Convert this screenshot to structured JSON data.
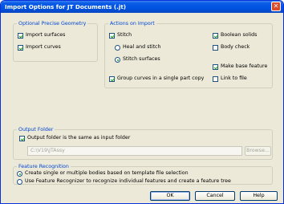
{
  "dialog": {
    "title": "Import Options for JT Documents (.jt)"
  },
  "optional_geometry": {
    "legend": "Optional Precise Geometry",
    "import_surfaces": {
      "label": "Import surfaces",
      "checked": true
    },
    "import_curves": {
      "label": "Import curves",
      "checked": true
    }
  },
  "actions": {
    "legend": "Actions on Import",
    "stitch": {
      "label": "Stitch",
      "checked": true
    },
    "heal_and_stitch": {
      "label": "Heal and stitch",
      "selected": false
    },
    "stitch_surfaces": {
      "label": "Stitch surfaces",
      "selected": true
    },
    "group_curves": {
      "label": "Group curves in a single part copy",
      "checked": true
    },
    "boolean_solids": {
      "label": "Boolean solids",
      "checked": true
    },
    "body_check": {
      "label": "Body check",
      "checked": false
    },
    "make_base_feature": {
      "label": "Make base feature",
      "checked": true
    },
    "link_to_file": {
      "label": "Link to file",
      "checked": false
    }
  },
  "output_folder": {
    "legend": "Output Folder",
    "same_as_input": {
      "label": "Output folder is the same as input folder",
      "checked": true
    },
    "path": "C:\\V19\\JTAssy",
    "browse_label": "Browse..."
  },
  "feature_recognition": {
    "legend": "Feature Recognition",
    "option_single": {
      "label": "Create single or multiple bodies based on template file selection",
      "selected": true
    },
    "option_recognizer": {
      "label": "Use Feature Recognizer to recognize individual features and create a feature tree",
      "selected": false
    }
  },
  "buttons": {
    "ok": "OK",
    "cancel": "Cancel",
    "help": "Help"
  }
}
